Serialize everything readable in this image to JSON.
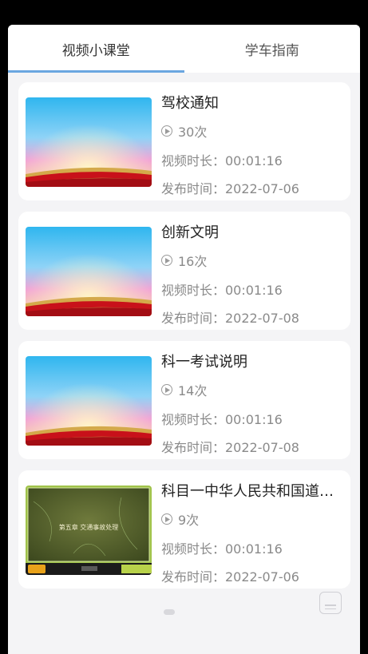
{
  "tabs": [
    {
      "label": "视频小课堂",
      "active": true
    },
    {
      "label": "学车指南",
      "active": false
    }
  ],
  "videos": [
    {
      "title": "驾校通知",
      "views": "30次",
      "duration": "视频时长：00:01:16",
      "date": "发布时间：2022-07-06",
      "thumbnail": "sky-gradient-stage"
    },
    {
      "title": "创新文明",
      "views": "16次",
      "duration": "视频时长：00:01:16",
      "date": "发布时间：2022-07-08",
      "thumbnail": "sky-gradient-stage"
    },
    {
      "title": "科一考试说明",
      "views": "14次",
      "duration": "视频时长：00:01:16",
      "date": "发布时间：2022-07-08",
      "thumbnail": "sky-gradient-stage"
    },
    {
      "title": "科目一中华人民共和国道路交通安全法",
      "views": "9次",
      "duration": "视频时长：00:01:16",
      "date": "发布时间：2022-07-06",
      "thumbnail": "lecture-slide",
      "slide_text": "第五章 交通事故处理"
    }
  ],
  "colors": {
    "accent": "#6aa6e0",
    "background": "#f4f4f6",
    "card": "#ffffff",
    "meta_text": "#8a8a8a"
  },
  "icons": {
    "views": "play-circle-icon",
    "floating": "note-icon"
  }
}
